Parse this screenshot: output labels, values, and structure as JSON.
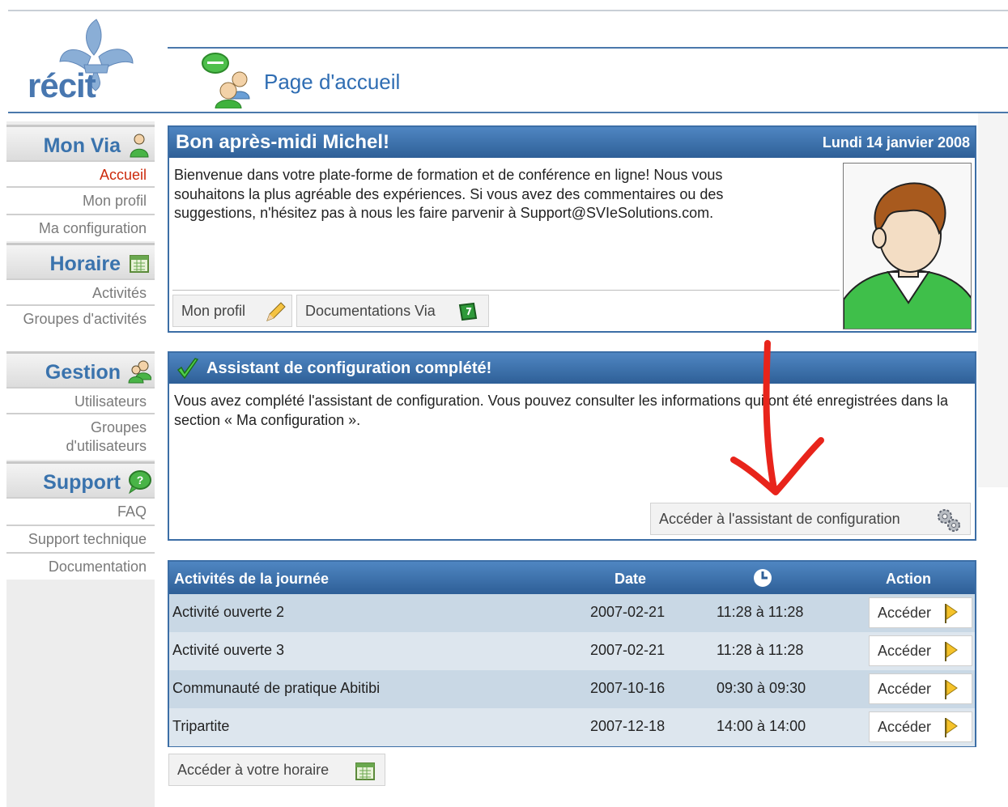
{
  "header": {
    "logo_text": "récit",
    "page_title": "Page d'accueil"
  },
  "sidebar": {
    "sections": [
      {
        "title": "Mon Via",
        "icon": "user-icon",
        "items": [
          "Accueil",
          "Mon profil",
          "Ma configuration"
        ]
      },
      {
        "title": "Horaire",
        "icon": "calendar-icon",
        "items": [
          "Activités",
          "Groupes d'activités"
        ]
      },
      {
        "title": "Gestion",
        "icon": "users-icon",
        "items": [
          "Utilisateurs",
          "Groupes d'utilisateurs"
        ]
      },
      {
        "title": "Support",
        "icon": "speech-bubble-icon",
        "items": [
          "FAQ",
          "Support technique",
          "Documentation"
        ]
      }
    ],
    "active_item": "Accueil",
    "active_color": "#cc2a0c"
  },
  "welcome": {
    "title": "Bon après-midi Michel!",
    "date": "Lundi 14 janvier 2008",
    "text": "Bienvenue dans votre plate-forme de formation et de conférence en ligne! Nous vous souhaitons la plus agréable des expériences. Si vous avez des commentaires ou des suggestions, n'hésitez pas à nous les faire parvenir à Support@SVIeSolutions.com.",
    "btn_profile": "Mon profil",
    "btn_docs": "Documentations Via"
  },
  "assistant": {
    "title": "Assistant de configuration complété!",
    "text": "Vous avez complété l'assistant de configuration. Vous pouvez consulter les informations qui ont été enregistrées dans la section « Ma configuration ».",
    "btn": "Accéder à l'assistant de configuration"
  },
  "activities": {
    "headers": {
      "name": "Activités de la journée",
      "date": "Date",
      "time_icon": "clock-icon",
      "action": "Action"
    },
    "rows": [
      {
        "name": "Activité ouverte 2",
        "date": "2007-02-21",
        "time": "11:28 à 11:28",
        "action": "Accéder"
      },
      {
        "name": "Activité ouverte 3",
        "date": "2007-02-21",
        "time": "11:28 à 11:28",
        "action": "Accéder"
      },
      {
        "name": "Communauté de pratique Abitibi",
        "date": "2007-10-16",
        "time": "09:30 à 09:30",
        "action": "Accéder"
      },
      {
        "name": "Tripartite",
        "date": "2007-12-18",
        "time": "14:00 à 14:00",
        "action": "Accéder"
      }
    ],
    "schedule_btn": "Accéder à votre horaire"
  },
  "colors": {
    "accent": "#3c6ea6",
    "annotation_arrow": "#e8241b"
  }
}
